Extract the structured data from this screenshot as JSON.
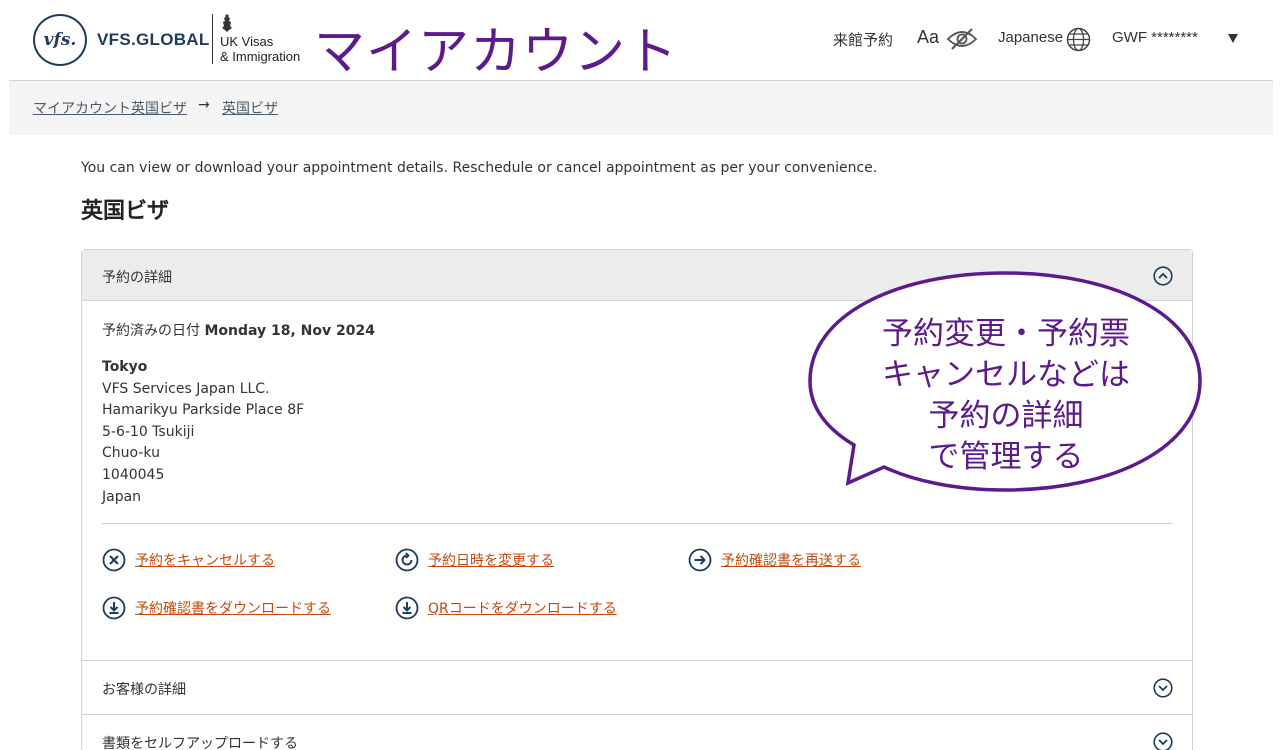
{
  "header": {
    "brand": "VFS.GLOBAL",
    "brand_mark": "vfs.",
    "partner_line1": "UK Visas",
    "partner_line2": "& Immigration",
    "page_heading": "マイアカウント",
    "nav": {
      "visit": "来館予約",
      "font_size": "Aa",
      "language": "Japanese",
      "user": "GWF ********"
    }
  },
  "breadcrumb": {
    "items": [
      "マイアカウント英国ビザ",
      "英国ビザ"
    ],
    "separator": "→"
  },
  "intro": "You can view or download your appointment details. Reschedule or cancel appointment as per your convenience.",
  "section_title": "英国ビザ",
  "appointment": {
    "panel_title": "予約の詳細",
    "date_label": "予約済みの日付",
    "date_value": "Monday 18, Nov 2024",
    "address": {
      "city": "Tokyo",
      "lines": [
        "VFS Services Japan LLC.",
        "Hamarikyu Parkside Place 8F",
        "5-6-10 Tsukiji",
        "Chuo-ku",
        "1040045",
        "Japan"
      ]
    },
    "actions": {
      "cancel": "予約をキャンセルする",
      "reschedule": "予約日時を変更する",
      "resend": "予約確認書を再送する",
      "download_letter": "予約確認書をダウンロードする",
      "download_qr": "QRコードをダウンロードする"
    }
  },
  "sections": {
    "customer": "お客様の詳細",
    "upload": "書類をセルフアップロードする"
  },
  "callout": {
    "lines": [
      "予約変更・予約票",
      "キャンセルなどは",
      "予約の詳細",
      "で管理する"
    ]
  },
  "colors": {
    "accent_purple": "#5c1a8c",
    "link_orange": "#c34a0a",
    "icon_navy": "#1f3a5f"
  }
}
